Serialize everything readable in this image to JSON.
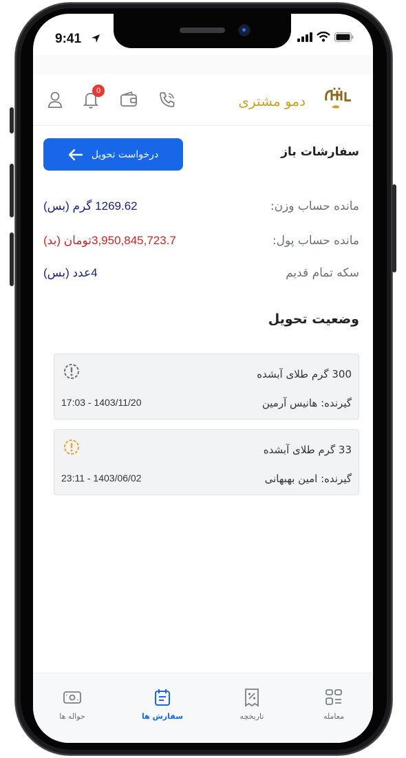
{
  "status_bar": {
    "time": "9:41"
  },
  "header": {
    "brand_name": "دمو مشتری",
    "notification_count": "0",
    "icons": [
      "profile-icon",
      "bell-icon",
      "wallet-icon",
      "phone-call-icon"
    ]
  },
  "orders": {
    "section_title": "سفارشات باز",
    "request_button": "درخواست تحویل",
    "rows": [
      {
        "label": "مانده حساب وزن:",
        "value": "1269.62 گرم (بس)",
        "color": "#1a237e"
      },
      {
        "label": "مانده حساب پول:",
        "value": "3,950,845,723.7تومان (بد)",
        "color": "#c62828"
      },
      {
        "label": "سکه تمام قدیم",
        "value": "4عدد (بس)",
        "color": "#1a237e"
      }
    ]
  },
  "delivery": {
    "section_title": "وضعیت تحویل",
    "items": [
      {
        "title": "300 گرم طلای آبشده",
        "receiver": "گیرنده: هانیس آرمین",
        "datetime": "17:03 - 1403/11/20",
        "status_color": "#6b6f76"
      },
      {
        "title": "33 گرم طلای آبشده",
        "receiver": "گیرنده: امین بهبهانی",
        "datetime": "23:11 - 1403/06/02",
        "status_color": "#f0a030"
      }
    ]
  },
  "bottom_nav": {
    "items": [
      {
        "label": "معامله",
        "icon": "trade-icon",
        "active": false
      },
      {
        "label": "تاریخچه",
        "icon": "history-icon",
        "active": false
      },
      {
        "label": "سفارش ها",
        "icon": "orders-icon",
        "active": true
      },
      {
        "label": "حواله ها",
        "icon": "transfers-icon",
        "active": false
      }
    ],
    "accent_color": "#1867e8"
  }
}
